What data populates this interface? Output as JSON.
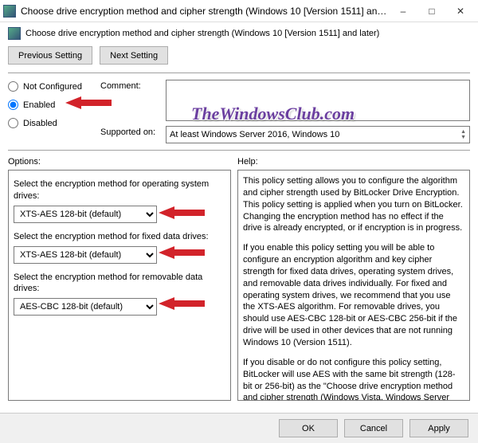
{
  "window": {
    "title": "Choose drive encryption method and cipher strength (Windows 10 [Version 1511] and later)",
    "subtitle": "Choose drive encryption method and cipher strength (Windows 10 [Version 1511] and later)"
  },
  "nav": {
    "previous": "Previous Setting",
    "next": "Next Setting"
  },
  "state": {
    "not_configured": "Not Configured",
    "enabled": "Enabled",
    "disabled": "Disabled",
    "selected": "enabled"
  },
  "fields": {
    "comment_label": "Comment:",
    "comment_value": "",
    "supported_label": "Supported on:",
    "supported_value": "At least Windows Server 2016, Windows 10"
  },
  "watermark": "TheWindowsClub.com",
  "panels": {
    "options_label": "Options:",
    "help_label": "Help:"
  },
  "options": {
    "os_label": "Select the encryption method for operating system drives:",
    "os_value": "XTS-AES 128-bit (default)",
    "fixed_label": "Select the encryption method for fixed data drives:",
    "fixed_value": "XTS-AES 128-bit (default)",
    "removable_label": "Select the encryption method for removable data drives:",
    "removable_value": "AES-CBC 128-bit  (default)"
  },
  "help": {
    "p1": "This policy setting allows you to configure the algorithm and cipher strength used by BitLocker Drive Encryption. This policy setting is applied when you turn on BitLocker. Changing the encryption method has no effect if the drive is already encrypted, or if encryption is in progress.",
    "p2": "If you enable this policy setting you will be able to configure an encryption algorithm and key cipher strength for fixed data drives, operating system drives, and removable data drives individually. For fixed and operating system drives, we recommend that you use the XTS-AES algorithm. For removable drives, you should use AES-CBC 128-bit or AES-CBC 256-bit if the drive will be used in other devices that are not running Windows 10 (Version 1511).",
    "p3": "If you disable or do not configure this policy setting, BitLocker will use AES with the same bit strength (128-bit or 256-bit) as the \"Choose drive encryption method and cipher strength (Windows Vista, Windows Server 2008, Windows 7)\" and \"Choose drive encryption method and cipher strength\" policy settings (in that"
  },
  "footer": {
    "ok": "OK",
    "cancel": "Cancel",
    "apply": "Apply"
  }
}
